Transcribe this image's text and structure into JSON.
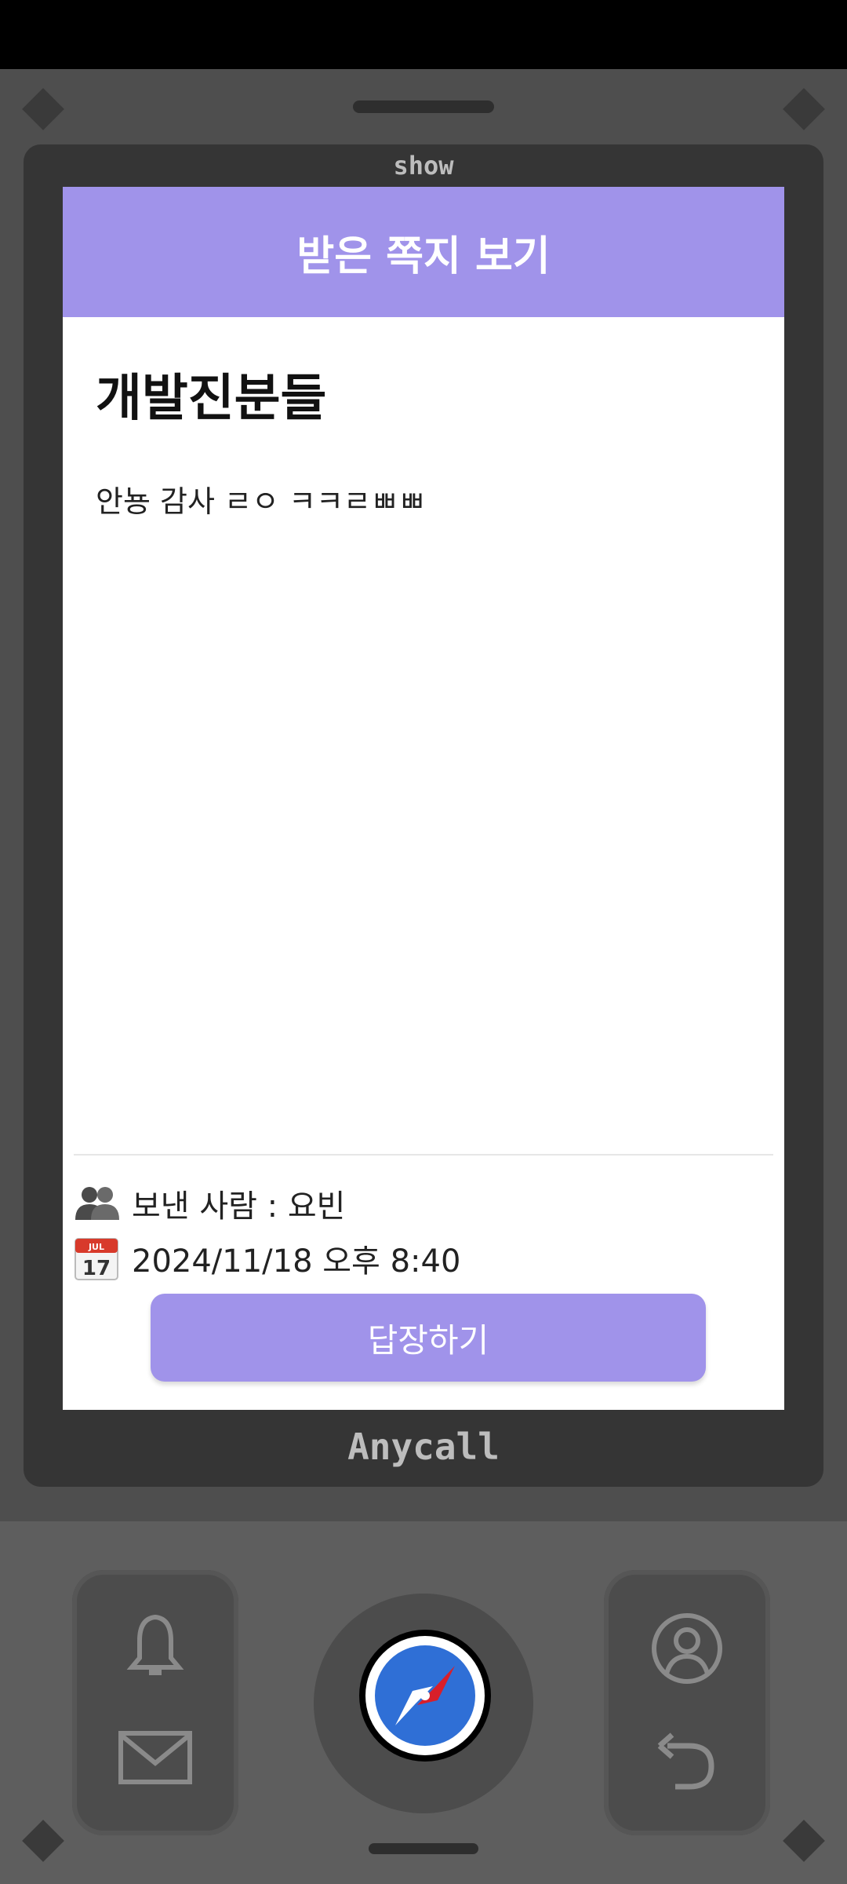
{
  "phone": {
    "brand_top": "show",
    "brand_bottom": "Anycall"
  },
  "header": {
    "title": "받은 쪽지 보기"
  },
  "message": {
    "title": "개발진분들",
    "body": "안뇽 감사 ㄹㅇ ㅋㅋㄹㅃㅃ"
  },
  "meta": {
    "sender": "보낸 사람 : 요빈",
    "datetime": "2024/11/18 오후 8:40",
    "calendar_month": "JUL",
    "calendar_day": "17"
  },
  "actions": {
    "reply_label": "답장하기"
  },
  "icons": [
    "bell-icon",
    "mail-icon",
    "compass-icon",
    "contacts-icon",
    "back-icon",
    "users-icon",
    "calendar-icon"
  ],
  "colors": {
    "accent": "#a093ea",
    "phone_body": "#4e4e4e",
    "bezel": "#353535"
  }
}
